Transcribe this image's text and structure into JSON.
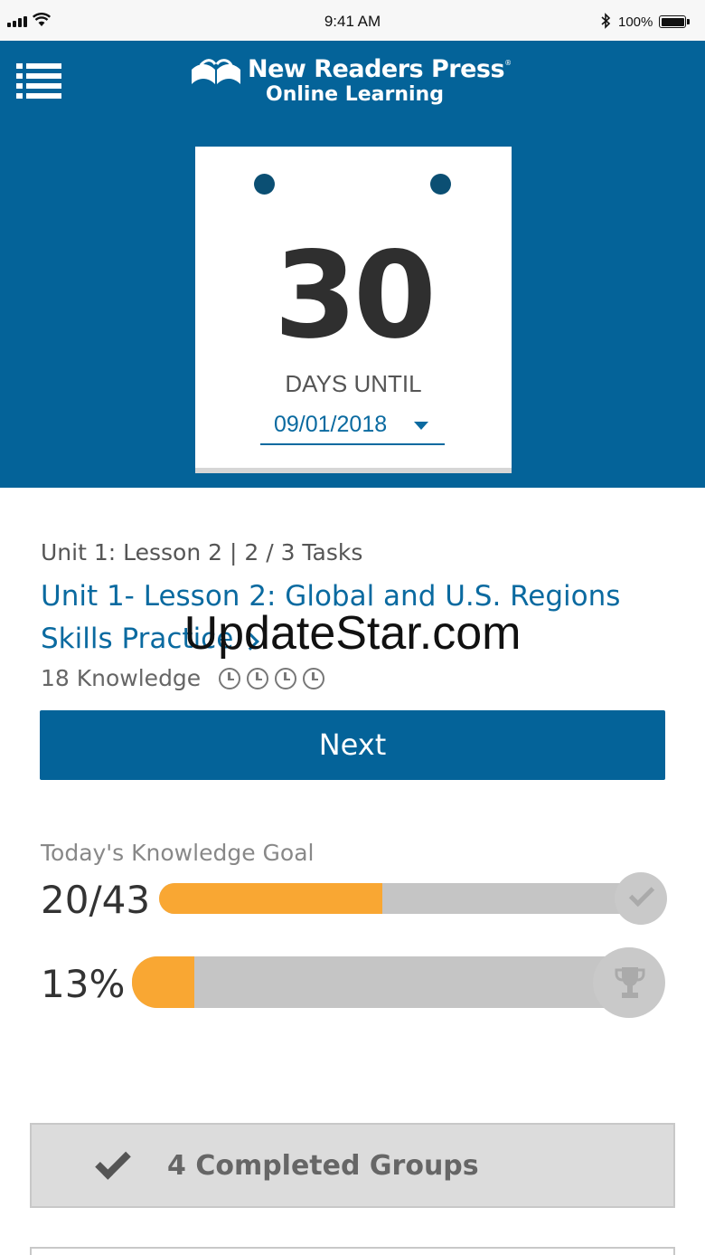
{
  "status_bar": {
    "time": "9:41 AM",
    "battery_percent": "100%"
  },
  "brand": {
    "name": "New Readers Press",
    "trademark": "®",
    "subtitle": "Online Learning"
  },
  "countdown": {
    "days": "30",
    "label": "DAYS UNTIL",
    "selected_date": "09/01/2018"
  },
  "lesson": {
    "meta": "Unit 1: Lesson 2 | 2 / 3 Tasks",
    "title": "Unit 1- Lesson 2: Global and U.S. Regions Skills Practice",
    "knowledge": "18 Knowledge",
    "clock_icons": 4,
    "next_label": "Next"
  },
  "goal": {
    "label": "Today's Knowledge Goal",
    "value_text": "20/43",
    "value": 20,
    "total": 43,
    "percent_text": "13%",
    "percent": 13,
    "accent_color": "#f9a733",
    "track_color": "#c5c5c5"
  },
  "completed_groups": {
    "label": "4 Completed Groups"
  },
  "watermark": "UpdateStar.com",
  "colors": {
    "header_bg": "#046399",
    "link": "#0a6aa0"
  }
}
